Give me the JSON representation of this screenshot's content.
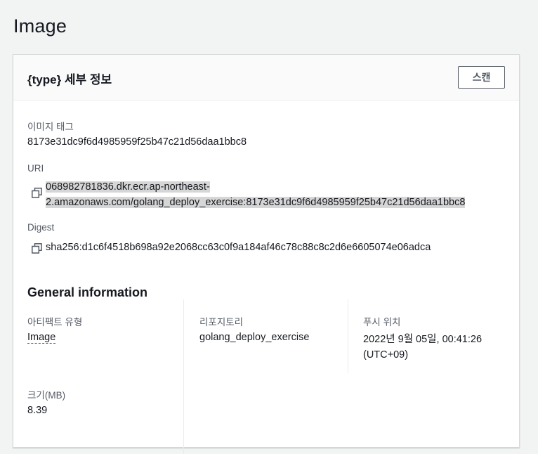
{
  "page": {
    "title": "Image"
  },
  "panel": {
    "title": "{type} 세부 정보",
    "scan_button": "스캔"
  },
  "details": {
    "image_tag": {
      "label": "이미지 태그",
      "value": "8173e31dc9f6d4985959f25b47c21d56daa1bbc8"
    },
    "uri": {
      "label": "URI",
      "line1": "068982781836.dkr.ecr.ap-northeast-",
      "line2": "2.amazonaws.com/golang_deploy_exercise:8173e31dc9f6d4985959f25b47c21d56daa1bbc8"
    },
    "digest": {
      "label": "Digest",
      "value": "sha256:d1c6f4518b698a92e2068cc63c0f9a184af46c78c88c8c2d6e6605074e06adca"
    }
  },
  "general": {
    "title": "General information",
    "artifact_type": {
      "label": "아티팩트 유형",
      "value": "Image"
    },
    "repository": {
      "label": "리포지토리",
      "value": "golang_deploy_exercise"
    },
    "pushed_at": {
      "label": "푸시 위치",
      "line1": "2022년 9월 05일, 00:41:26",
      "line2": "(UTC+09)"
    },
    "size": {
      "label": "크기(MB)",
      "value": "8.39"
    }
  },
  "icons": {
    "copy": "copy-icon"
  }
}
